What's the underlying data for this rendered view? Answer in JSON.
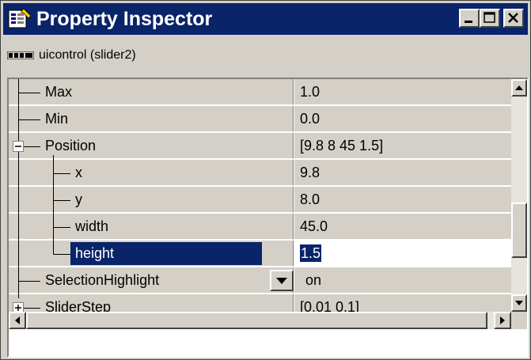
{
  "window": {
    "title": "Property Inspector",
    "object_label": "uicontrol (slider2)"
  },
  "properties": [
    {
      "name": "Max",
      "value": "1.0"
    },
    {
      "name": "Min",
      "value": "0.0"
    },
    {
      "name": "Position",
      "value": "[9.8 8 45 1.5]",
      "expander": "collapse"
    },
    {
      "name": "x",
      "value": "9.8"
    },
    {
      "name": "y",
      "value": "8.0"
    },
    {
      "name": "width",
      "value": "45.0"
    },
    {
      "name": "height",
      "value": "1.5",
      "selected": true,
      "editing": true
    },
    {
      "name": "SelectionHighlight",
      "value": "on",
      "dropdown": true
    },
    {
      "name": "SliderStep",
      "value": "[0.01 0.1]",
      "expander": "expand"
    }
  ],
  "colors": {
    "title_bar": "#0a246a",
    "selection": "#0a246a",
    "face": "#d4d0c8"
  }
}
